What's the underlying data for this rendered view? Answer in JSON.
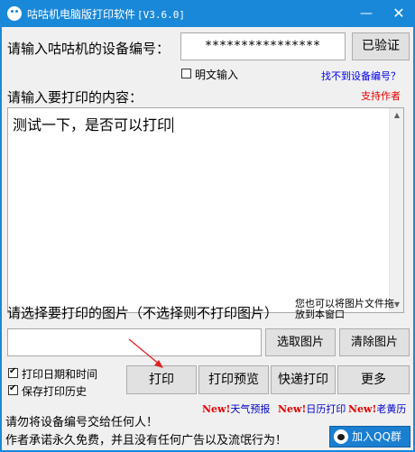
{
  "window": {
    "title": "咕咕机电脑版打印软件",
    "version": "[V3.6.0]",
    "minimize_glyph": "—",
    "close_glyph": "✕"
  },
  "device": {
    "label": "请输入咕咕机的设备编号：",
    "value": "****************",
    "verify_button": "已验证",
    "show_plain_label": "明文输入",
    "show_plain_checked": false,
    "not_found_link": "找不到设备编号？"
  },
  "content": {
    "label": "请输入要打印的内容：",
    "support_link": "支持作者",
    "text": "测试一下，是否可以打印"
  },
  "image": {
    "label": "请选择要打印的图片（不选择则不打印图片）",
    "drag_hint": "您也可以将图片文件拖放到本窗口",
    "value": "",
    "select_button": "选取图片",
    "clear_button": "清除图片"
  },
  "options": {
    "print_date_label": "打印日期和时间",
    "print_date_checked": true,
    "save_history_label": "保存打印历史",
    "save_history_checked": true
  },
  "actions": {
    "print": "打印",
    "preview": "打印预览",
    "quick_print": "快递打印",
    "more": "更多"
  },
  "promos": {
    "new_tag": "New!",
    "weather": "天气预报",
    "calendar": "日历打印",
    "almanac": "老黄历"
  },
  "notices": {
    "line1": "请勿将设备编号交给任何人！",
    "line2": "作者承诺永久免费，并且没有任何广告以及流氓行为！"
  },
  "qq_group_button": "加入QQ群",
  "colors": {
    "titlebar": "#1a88d8",
    "link_blue": "#0000ee",
    "link_red": "#e60000",
    "arrow_red": "#e02020"
  },
  "icons": {
    "app": "pigeon-logo-icon",
    "qq": "qq-penguin-icon"
  }
}
